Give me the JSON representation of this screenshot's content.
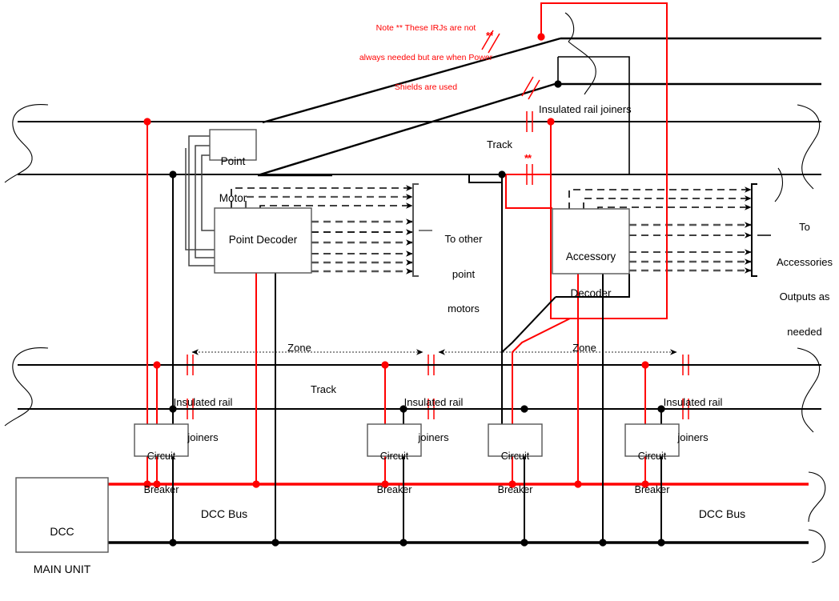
{
  "diagram": {
    "title": "DCC Wiring Diagram",
    "colors": {
      "power_red": "#ff0000",
      "ground_black": "#000000",
      "rail": "#000000",
      "box_outline": "#555555",
      "note_red": "#ff0000"
    },
    "note": {
      "line1": "Note ** These IRJs are not",
      "line2": "always needed but are when Power",
      "line3": "Shields are used"
    },
    "boxes": {
      "dcc_main_unit": {
        "line1": "DCC",
        "line2": "MAIN UNIT"
      },
      "point_motor": {
        "line1": "Point",
        "line2": "Motor"
      },
      "point_decoder": {
        "line1": "Point Decoder"
      },
      "accessory_decoder": {
        "line1": "Accessory",
        "line2": "Decoder"
      },
      "circuit_breaker": {
        "line1": "Circuit",
        "line2": "Breaker"
      }
    },
    "circuit_breakers": [
      {
        "id": "cb-1",
        "label_line1": "Circuit",
        "label_line2": "Breaker"
      },
      {
        "id": "cb-2",
        "label_line1": "Circuit",
        "label_line2": "Breaker"
      },
      {
        "id": "cb-3",
        "label_line1": "Circuit",
        "label_line2": "Breaker"
      },
      {
        "id": "cb-4",
        "label_line1": "Circuit",
        "label_line2": "Breaker"
      }
    ],
    "labels": {
      "insulated_rail_joiners_line1": "Insulated rail",
      "insulated_rail_joiners_line2": "joiners",
      "insulated_rail_joiners_inline": "Insulated rail joiners",
      "track": "Track",
      "zone": "Zone",
      "dcc_bus": "DCC Bus",
      "to_other_point_motors_l1": "To other",
      "to_other_point_motors_l2": "point",
      "to_other_point_motors_l3": "motors",
      "to_accessories_l1": "To",
      "to_accessories_l2": "Accessories",
      "to_accessories_l3": "Outputs as",
      "to_accessories_l4": "needed",
      "asterisks": "**"
    },
    "label_instances": {
      "track_upper": "Track",
      "track_lower": "Track",
      "zone_left": "Zone",
      "zone_right": "Zone",
      "dcc_bus_left": "DCC Bus",
      "dcc_bus_right": "DCC Bus",
      "irj_top": "Insulated rail joiners",
      "irj_1_l1": "Insulated rail",
      "irj_1_l2": "joiners",
      "irj_2_l1": "Insulated rail",
      "irj_2_l2": "joiners",
      "irj_3_l1": "Insulated rail",
      "irj_3_l2": "joiners"
    }
  }
}
